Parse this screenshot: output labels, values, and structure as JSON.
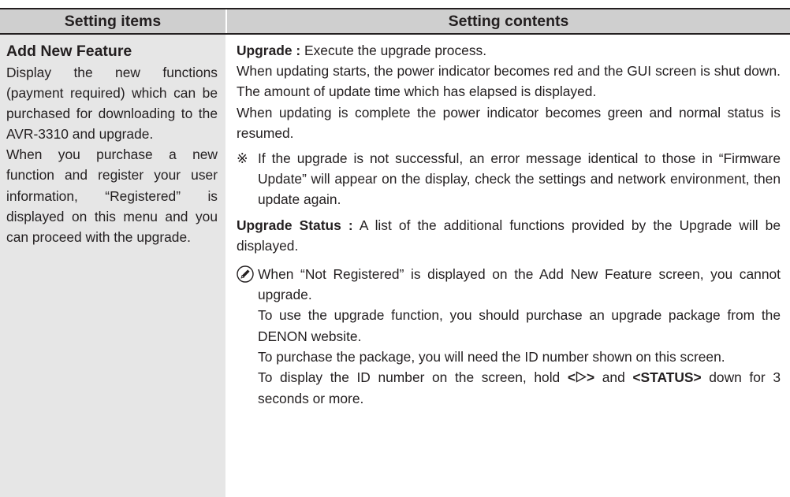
{
  "header": {
    "col_items": "Setting items",
    "col_contents": "Setting contents"
  },
  "item": {
    "title": "Add New Feature",
    "description": "Display the new functions (payment required) which can be purchased for downloading to the AVR-3310 and upgrade.",
    "description2": "When you purchase a new function and register your user information, “Registered” is displayed on this menu and you can proceed with the upgrade."
  },
  "contents": {
    "upgrade_label": "Upgrade :",
    "upgrade_text": " Execute the upgrade process.",
    "updating_starts": "When updating starts, the power indicator becomes red and the GUI screen is shut down. The amount of update time which has elapsed is displayed.",
    "updating_complete": "When updating is complete the power indicator becomes green and normal status is resumed.",
    "note_mark": "※",
    "note_text": "If the upgrade is not successful, an error message identical to those in “Firmware Update” will appear on the display, check the settings and network environment, then update again.",
    "status_label": "Upgrade Status :",
    "status_text": " A list of the additional functions provided by the Upgrade will be displayed.",
    "memo_1": "When “Not Registered” is displayed on the Add New Feature screen, you cannot upgrade.",
    "memo_2": "To use the upgrade function, you should purchase an upgrade package from the DENON website.",
    "memo_3": "To purchase the package, you will need the ID number shown on this screen.",
    "memo_4_pre": "To display the ID number on the screen, hold ",
    "memo_4_key1_open": "<",
    "memo_4_key1_close": ">",
    "memo_4_mid": " and ",
    "memo_4_key2": "<STATUS>",
    "memo_4_post": " down for 3 seconds or more."
  },
  "icons": {
    "memo_icon": "pencil-icon",
    "cursor_icon": "cursor-right-icon"
  },
  "colors": {
    "header_bg": "#cfcfcf",
    "left_col_bg": "#e6e6e6",
    "text": "#231f20"
  }
}
